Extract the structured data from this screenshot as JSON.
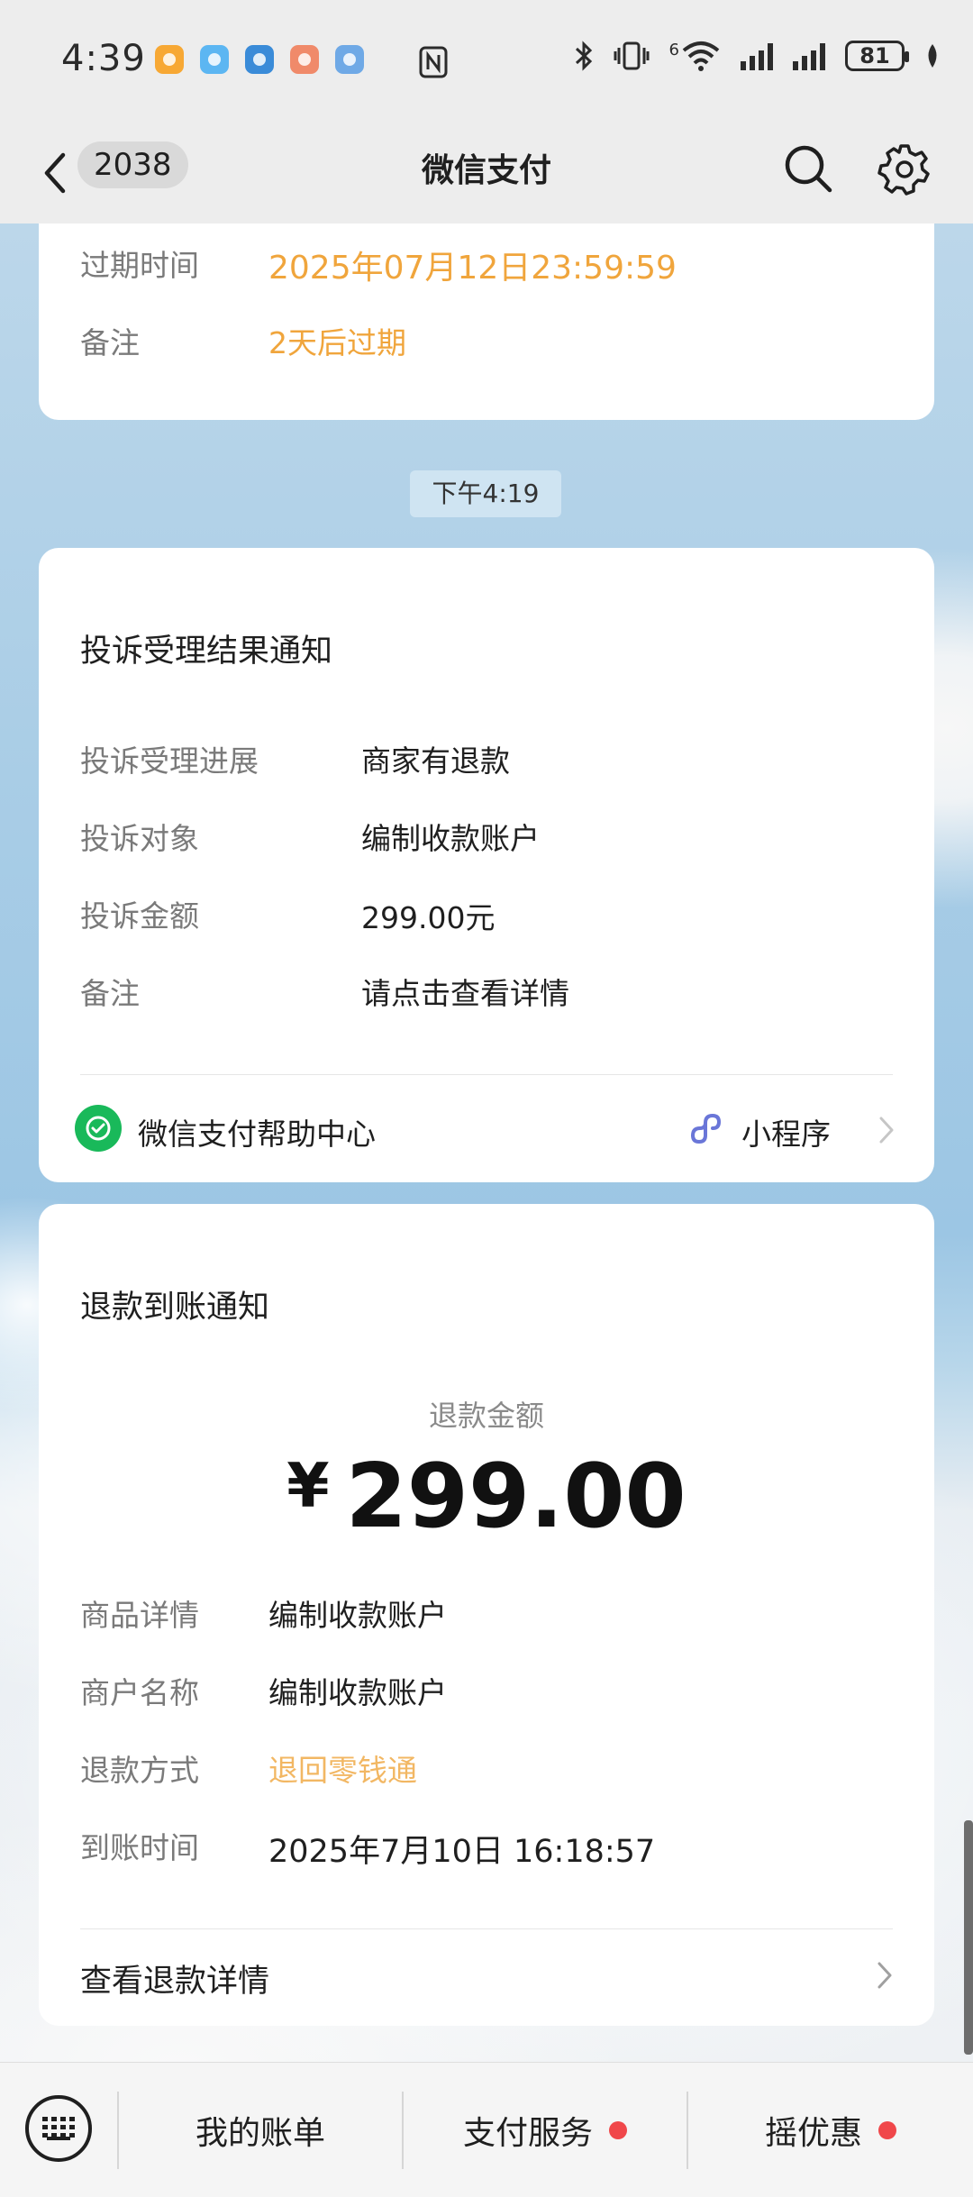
{
  "status_bar": {
    "time": "4:39",
    "battery": "81",
    "network_gen": "6",
    "app_icon_colors": [
      "#f7a834",
      "#5cb6f2",
      "#3a8bd8",
      "#f08a6a",
      "#6fa9e6"
    ]
  },
  "nav": {
    "unread_count": "2038",
    "title": "微信支付",
    "icons": [
      "back-chevron-icon",
      "search-icon",
      "gear-icon"
    ]
  },
  "card_partial": {
    "rows": [
      {
        "label": "过期时间",
        "value": "2025年07月12日23:59:59"
      },
      {
        "label": "备注",
        "value": "2天后过期"
      }
    ]
  },
  "timestamp": "下午4:19",
  "complaint_card": {
    "title": "投诉受理结果通知",
    "rows": [
      {
        "label": "投诉受理进展",
        "value": "商家有退款"
      },
      {
        "label": "投诉对象",
        "value": "编制收款账户"
      },
      {
        "label": "投诉金额",
        "value": "299.00元"
      },
      {
        "label": "备注",
        "value": "请点击查看详情"
      }
    ],
    "footer_source": "微信支付帮助中心",
    "footer_type": "小程序"
  },
  "refund_card": {
    "title": "退款到账通知",
    "amount_label": "退款金额",
    "currency": "¥",
    "amount": "299.00",
    "rows": [
      {
        "label": "商品详情",
        "value": "编制收款账户"
      },
      {
        "label": "商户名称",
        "value": "编制收款账户"
      },
      {
        "label": "退款方式",
        "value": "退回零钱通"
      },
      {
        "label": "到账时间",
        "value": "2025年7月10日  16:18:57"
      }
    ],
    "details_link": "查看退款详情"
  },
  "bottom_bar": {
    "items": [
      {
        "label": "我的账单",
        "has_dot": false
      },
      {
        "label": "支付服务",
        "has_dot": true
      },
      {
        "label": "摇优惠",
        "has_dot": true
      }
    ]
  },
  "colors": {
    "accent_orange": "#f0a53c",
    "wechat_green": "#19b95a",
    "notification_red": "#f0474a"
  }
}
